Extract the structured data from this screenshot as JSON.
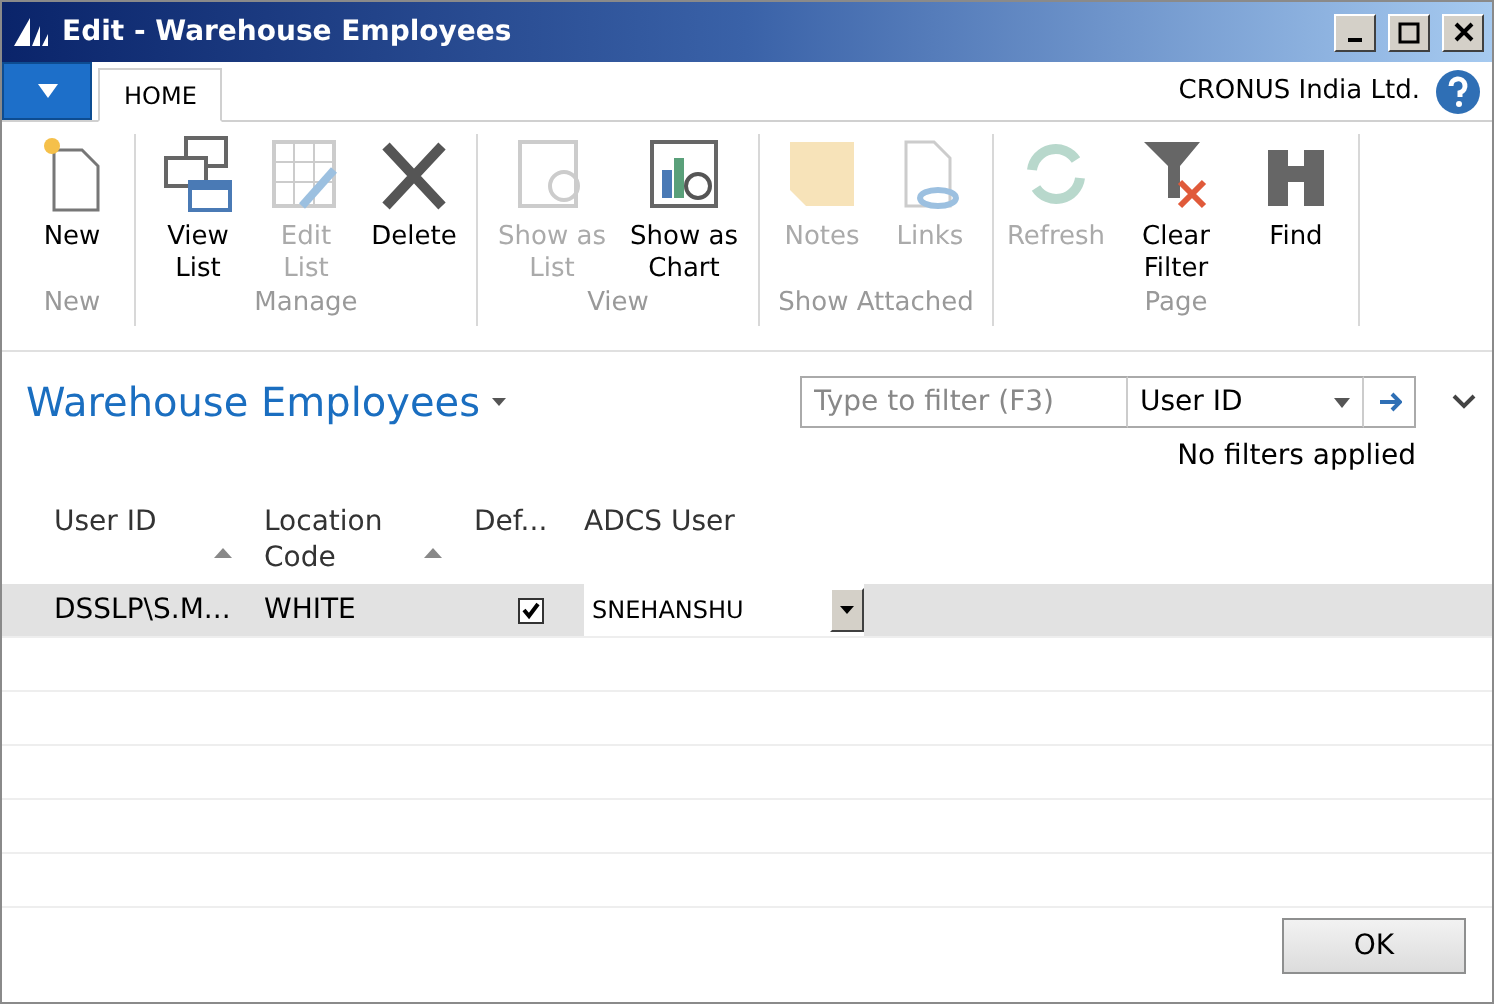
{
  "window": {
    "title": "Edit - Warehouse Employees"
  },
  "tabs": [
    {
      "label": "HOME",
      "selected": true
    }
  ],
  "company": "CRONUS India Ltd.",
  "ribbon": [
    {
      "group": "New",
      "actions": [
        {
          "label": "New",
          "disabled": false
        }
      ]
    },
    {
      "group": "Manage",
      "actions": [
        {
          "label": "View List",
          "disabled": false
        },
        {
          "label": "Edit List",
          "disabled": true
        },
        {
          "label": "Delete",
          "disabled": false
        }
      ]
    },
    {
      "group": "View",
      "actions": [
        {
          "label": "Show as List",
          "disabled": true
        },
        {
          "label": "Show as Chart",
          "disabled": false
        }
      ]
    },
    {
      "group": "Show Attached",
      "actions": [
        {
          "label": "Notes",
          "disabled": true
        },
        {
          "label": "Links",
          "disabled": true
        }
      ]
    },
    {
      "group": "Page",
      "actions": [
        {
          "label": "Refresh",
          "disabled": true
        },
        {
          "label": "Clear Filter",
          "disabled": false
        },
        {
          "label": "Find",
          "disabled": false
        }
      ]
    }
  ],
  "page_title": "Warehouse Employees",
  "filter": {
    "placeholder": "Type to filter (F3)",
    "field": "User ID",
    "status": "No filters applied"
  },
  "table": {
    "columns": [
      {
        "label": "User ID",
        "sort_arrow": true
      },
      {
        "label": "Location Code",
        "sort_arrow": true
      },
      {
        "label": "Def...",
        "sort_arrow": false
      },
      {
        "label": "ADCS User",
        "sort_arrow": false
      }
    ],
    "rows": [
      {
        "selected": true,
        "user_id": "DSSLP\\S.M...",
        "location_code": "WHITE",
        "default": true,
        "adcs_user": "SNEHANSHU"
      }
    ]
  },
  "buttons": [
    "OK"
  ]
}
